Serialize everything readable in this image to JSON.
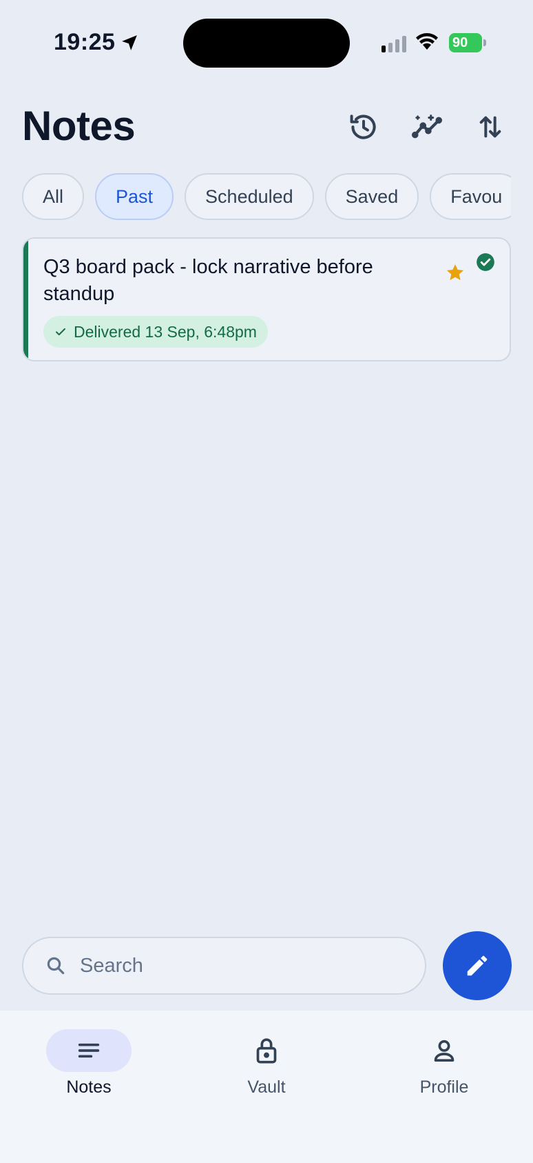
{
  "status_bar": {
    "time": "19:25",
    "battery": "90"
  },
  "header": {
    "title": "Notes",
    "icons": [
      "history-icon",
      "insights-icon",
      "sort-icon"
    ]
  },
  "filters": [
    {
      "label": "All",
      "active": false
    },
    {
      "label": "Past",
      "active": true
    },
    {
      "label": "Scheduled",
      "active": false
    },
    {
      "label": "Saved",
      "active": false
    },
    {
      "label": "Favou",
      "active": false
    }
  ],
  "notes": [
    {
      "title": "Q3 board pack - lock narrative before standup",
      "status": "Delivered 13 Sep, 6:48pm",
      "starred": true,
      "delivered": true
    }
  ],
  "search": {
    "placeholder": "Search",
    "value": ""
  },
  "bottom_nav": {
    "items": [
      {
        "label": "Notes",
        "icon": "notes-icon",
        "active": true
      },
      {
        "label": "Vault",
        "icon": "lock-icon",
        "active": false
      },
      {
        "label": "Profile",
        "icon": "person-icon",
        "active": false
      }
    ]
  },
  "colors": {
    "background": "#e8ecf4",
    "accent": "#1d55d6",
    "success": "#1b7a55",
    "star": "#e8a20c"
  }
}
